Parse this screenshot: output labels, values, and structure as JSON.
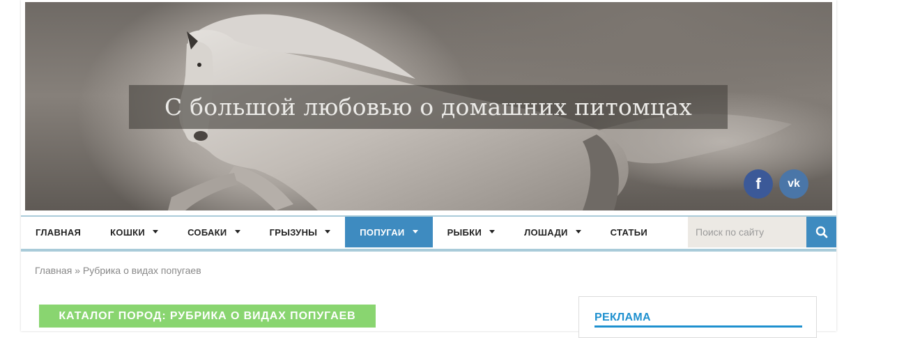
{
  "header": {
    "tagline": "С большой любовью о домашних питомцах",
    "social": {
      "facebook_label": "f",
      "vk_label": "vk"
    }
  },
  "nav": {
    "items": [
      {
        "label": "ГЛАВНАЯ",
        "dropdown": false,
        "active": false
      },
      {
        "label": "КОШКИ",
        "dropdown": true,
        "active": false
      },
      {
        "label": "СОБАКИ",
        "dropdown": true,
        "active": false
      },
      {
        "label": "ГРЫЗУНЫ",
        "dropdown": true,
        "active": false
      },
      {
        "label": "ПОПУГАИ",
        "dropdown": true,
        "active": true
      },
      {
        "label": "РЫБКИ",
        "dropdown": true,
        "active": false
      },
      {
        "label": "ЛОШАДИ",
        "dropdown": true,
        "active": false
      },
      {
        "label": "СТАТЬИ",
        "dropdown": false,
        "active": false
      }
    ],
    "search_placeholder": "Поиск по сайту",
    "search_icon": "search-icon"
  },
  "breadcrumb": {
    "home": "Главная",
    "separator": "»",
    "current": "Рубрика о видах попугаев"
  },
  "category": {
    "title": "КАТАЛОГ ПОРОД: РУБРИКА О ВИДАХ ПОПУГАЕВ"
  },
  "sidebar": {
    "widget_title": "РЕКЛАМА"
  },
  "colors": {
    "accent_blue": "#3e8bc0",
    "category_green": "#89d570",
    "widget_title_blue": "#1e90cf",
    "nav_border": "#a9cbd9",
    "facebook": "#3b5998",
    "vk": "#4a76a8"
  }
}
